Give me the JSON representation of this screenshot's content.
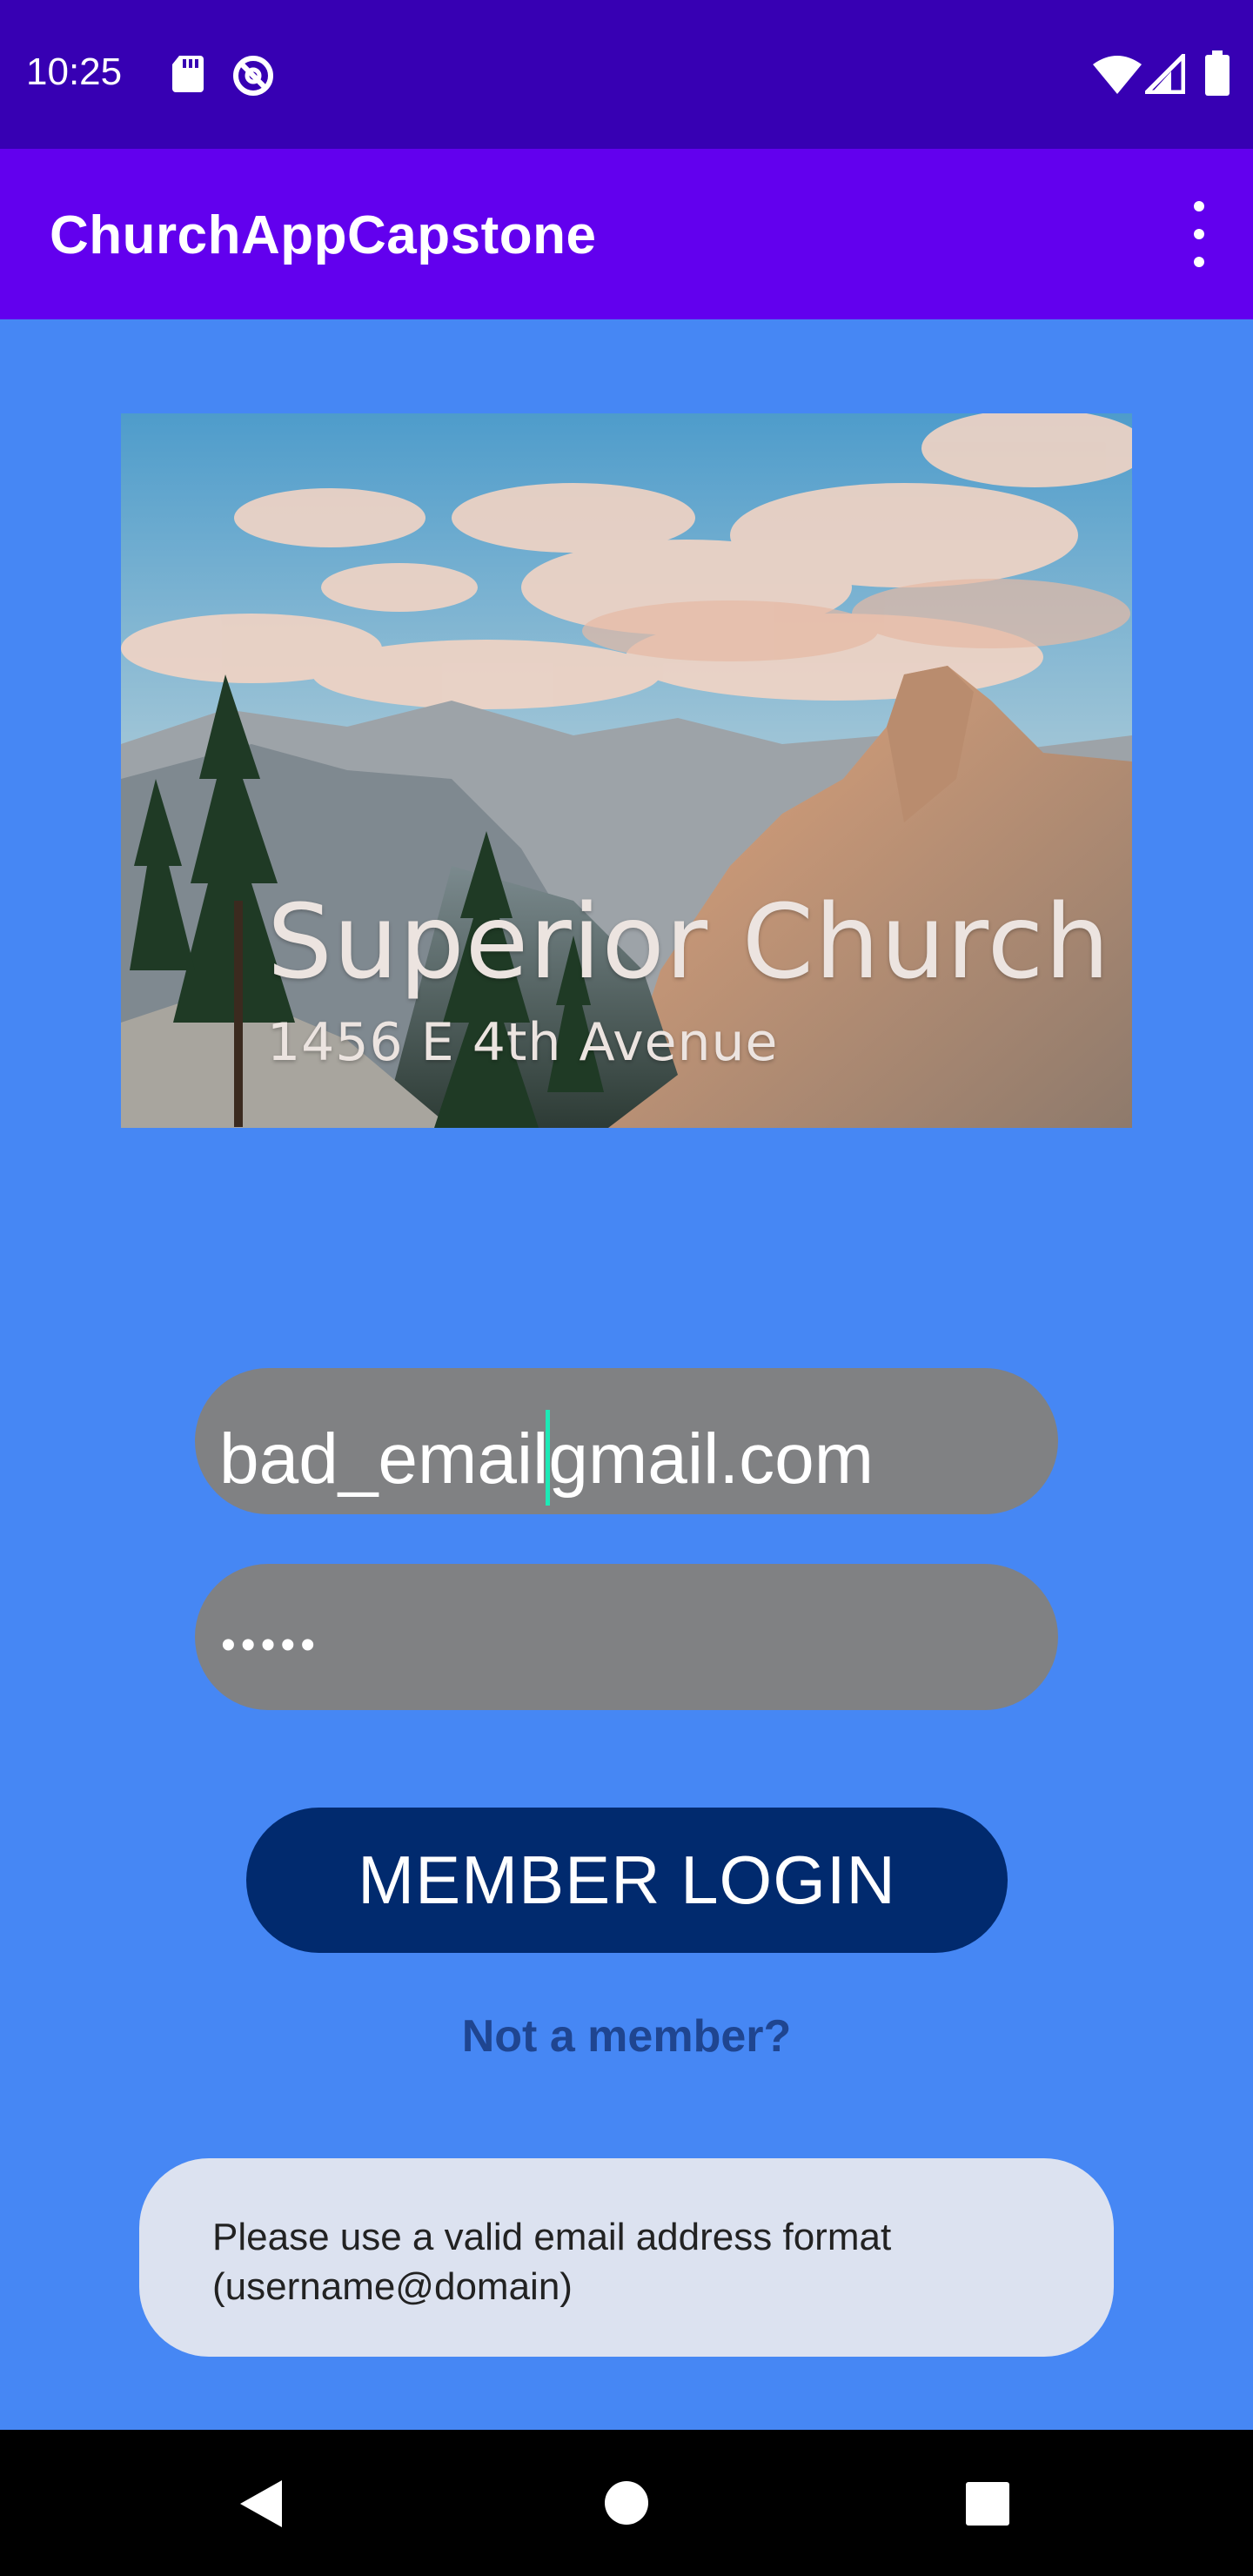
{
  "status_bar": {
    "time": "10:25",
    "icons": [
      "sd-card-icon",
      "do-not-disturb-icon",
      "wifi-icon",
      "signal-icon",
      "battery-icon"
    ]
  },
  "app_bar": {
    "title": "ChurchAppCapstone",
    "menu_icon": "more-vert-icon"
  },
  "banner": {
    "title": "Superior Church",
    "address": "1456 E 4th Avenue"
  },
  "form": {
    "email_before_cursor": "bad_email",
    "email_after_cursor": "gmail.com",
    "password_masked": "•••••"
  },
  "login_button": {
    "label": "MEMBER LOGIN"
  },
  "signup_link": {
    "label": "Not a member?"
  },
  "toast": {
    "message": "Please use a valid email address format (username@domain)"
  },
  "nav_bar": {
    "icons": [
      "back-icon",
      "home-icon",
      "recents-icon"
    ]
  },
  "colors": {
    "background": "#4687F4",
    "status_bar": "#3700B3",
    "app_bar": "#6200EE",
    "field": "#808183",
    "button": "#012A6E",
    "link": "#1F4590",
    "toast": "#DCE2F0",
    "cursor": "#1DE9B6"
  }
}
